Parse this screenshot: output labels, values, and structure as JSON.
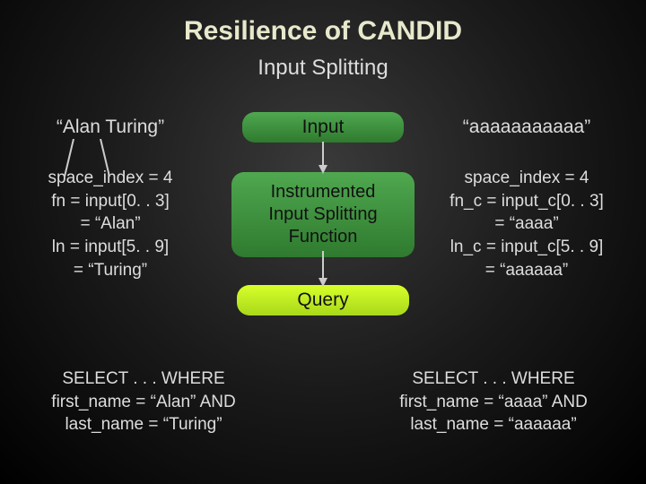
{
  "title": "Resilience of CANDID",
  "subtitle": "Input Splitting",
  "left": {
    "input": "“Alan Turing”",
    "a1": "space_index = 4",
    "a2": "fn = input[0. . 3]",
    "a3": "= “Alan”",
    "a4": "ln = input[5. . 9]",
    "a5": "= “Turing”",
    "sql1": "SELECT . . . WHERE",
    "sql2": "first_name = “Alan” AND",
    "sql3": "last_name = “Turing”"
  },
  "right": {
    "input": "“aaaaaaaaaaa”",
    "a1": "space_index = 4",
    "a2": "fn_c = input_c[0. . 3]",
    "a3": "= “aaaa”",
    "a4": "ln_c = input_c[5. . 9]",
    "a5": "= “aaaaaa”",
    "sql1": "SELECT . . . WHERE",
    "sql2": "first_name = “aaaa” AND",
    "sql3": "last_name = “aaaaaa”"
  },
  "center": {
    "input_box": "Input",
    "func_l1": "Instrumented",
    "func_l2": "Input Splitting",
    "func_l3": "Function",
    "query_box": "Query"
  }
}
